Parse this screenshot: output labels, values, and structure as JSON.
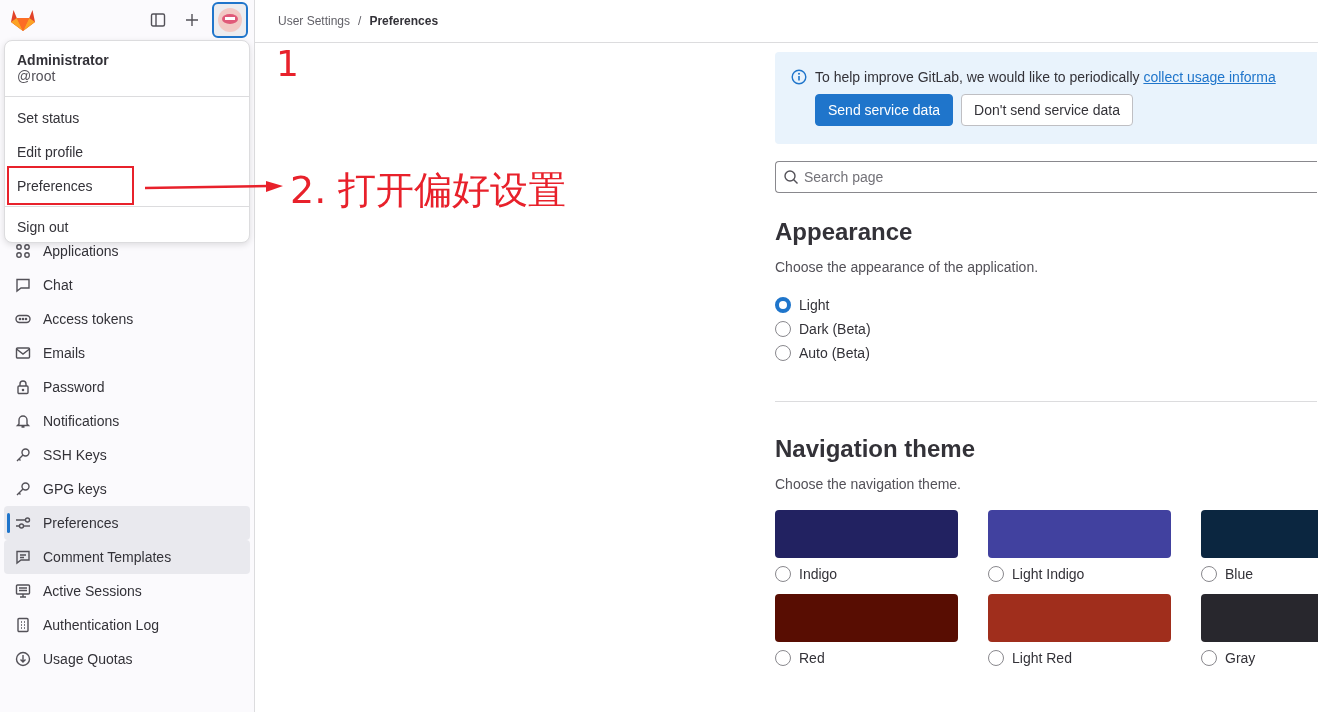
{
  "breadcrumbs": {
    "separator": "/",
    "items": [
      {
        "label": "User Settings",
        "current": false
      },
      {
        "label": "Preferences",
        "current": true
      }
    ]
  },
  "user_menu": {
    "name": "Administrator",
    "username": "@root",
    "items": [
      {
        "label": "Set status"
      },
      {
        "label": "Edit profile"
      },
      {
        "label": "Preferences"
      },
      {
        "label": "Sign out"
      }
    ]
  },
  "sidebar": {
    "items": [
      {
        "label": "Applications",
        "selected": false,
        "highlighted": false
      },
      {
        "label": "Chat",
        "selected": false,
        "highlighted": false
      },
      {
        "label": "Access tokens",
        "selected": false,
        "highlighted": false
      },
      {
        "label": "Emails",
        "selected": false,
        "highlighted": false
      },
      {
        "label": "Password",
        "selected": false,
        "highlighted": false
      },
      {
        "label": "Notifications",
        "selected": false,
        "highlighted": false
      },
      {
        "label": "SSH Keys",
        "selected": false,
        "highlighted": false
      },
      {
        "label": "GPG keys",
        "selected": false,
        "highlighted": false
      },
      {
        "label": "Preferences",
        "selected": true,
        "highlighted": false
      },
      {
        "label": "Comment Templates",
        "selected": false,
        "highlighted": true
      },
      {
        "label": "Active Sessions",
        "selected": false,
        "highlighted": false
      },
      {
        "label": "Authentication Log",
        "selected": false,
        "highlighted": false
      },
      {
        "label": "Usage Quotas",
        "selected": false,
        "highlighted": false
      }
    ]
  },
  "banner": {
    "text": "To help improve GitLab, we would like to periodically ",
    "link": "collect usage informa",
    "buttons": [
      {
        "label": "Send service data",
        "kind": "primary"
      },
      {
        "label": "Don't send service data",
        "kind": "secondary"
      }
    ]
  },
  "search": {
    "placeholder": "Search page"
  },
  "appearance": {
    "title": "Appearance",
    "description": "Choose the appearance of the application.",
    "options": [
      {
        "label": "Light",
        "selected": true
      },
      {
        "label": "Dark (Beta)",
        "selected": false
      },
      {
        "label": "Auto (Beta)",
        "selected": false
      }
    ]
  },
  "navigation_theme": {
    "title": "Navigation theme",
    "description": "Choose the navigation theme.",
    "themes": [
      {
        "label": "Indigo",
        "color": "#222261",
        "selected": false
      },
      {
        "label": "Light Indigo",
        "color": "#41419f",
        "selected": false
      },
      {
        "label": "Blue",
        "color": "#0b2640",
        "selected": false
      },
      {
        "label": "Red",
        "color": "#580d02",
        "selected": false
      },
      {
        "label": "Light Red",
        "color": "#a02e1c",
        "selected": false
      },
      {
        "label": "Gray",
        "color": "#28272d",
        "selected": false
      }
    ]
  },
  "annotations": [
    {
      "kind": "step",
      "text": "1"
    },
    {
      "kind": "arrow-step",
      "text": "2. 打开偏好设置"
    }
  ]
}
